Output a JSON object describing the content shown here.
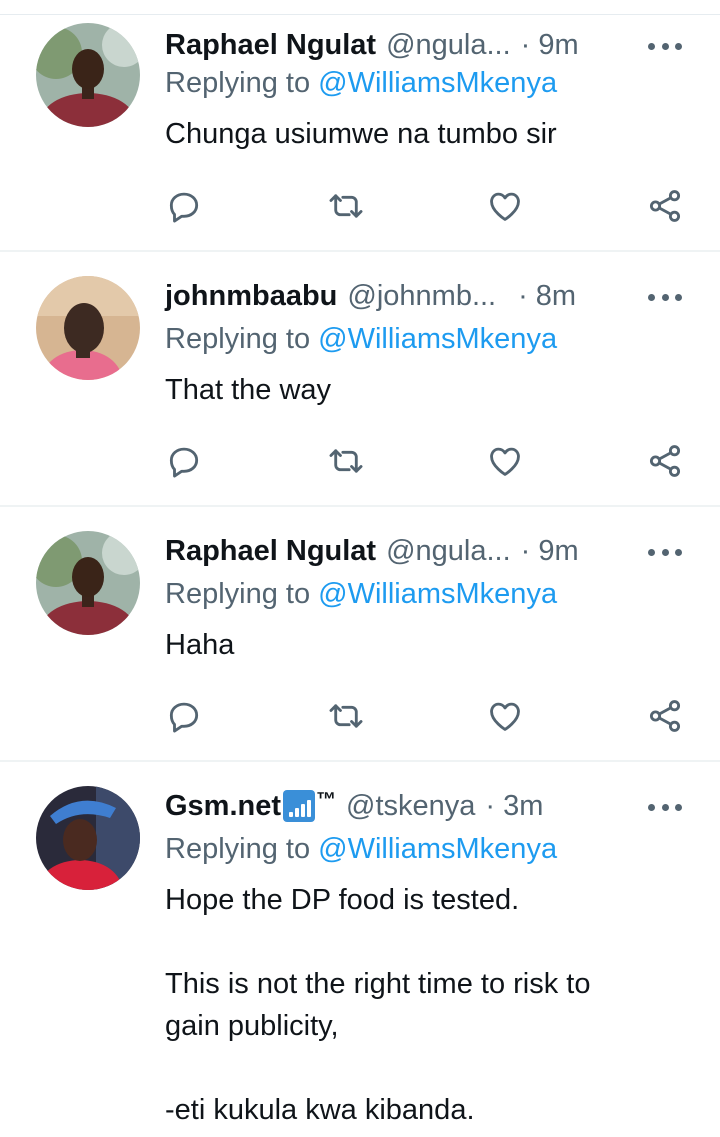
{
  "tweets": [
    {
      "name": "Raphael Ngulat",
      "handle": "@ngula...",
      "dot": "·",
      "time": "9m",
      "replying_prefix": "Replying to ",
      "replying_to": "@WilliamsMkenya",
      "lines": [
        "Chunga usiumwe na tumbo sir"
      ],
      "avatar": "avatar-raphael"
    },
    {
      "name": "johnmbaabu",
      "handle": "@johnmb...",
      "dot": "·",
      "time": "8m",
      "replying_prefix": "Replying to ",
      "replying_to": "@WilliamsMkenya",
      "lines": [
        "That the way"
      ],
      "avatar": "avatar-john"
    },
    {
      "name": "Raphael Ngulat",
      "handle": "@ngula...",
      "dot": "·",
      "time": "9m",
      "replying_prefix": "Replying to ",
      "replying_to": "@WilliamsMkenya",
      "lines": [
        "Haha"
      ],
      "avatar": "avatar-raphael"
    },
    {
      "name": "Gsm.net",
      "name_suffix": "™",
      "handle": "@tskenya",
      "dot": "·",
      "time": "3m",
      "replying_prefix": "Replying to ",
      "replying_to": "@WilliamsMkenya",
      "lines": [
        "Hope the DP food is tested.",
        "",
        "This is not the right time to risk to",
        "gain publicity,",
        "",
        "-eti kukula kwa kibanda."
      ],
      "avatar": "avatar-gsm"
    }
  ],
  "action_icons": [
    "reply-icon",
    "retweet-icon",
    "like-icon",
    "share-icon"
  ],
  "colors": {
    "text": "#0f1419",
    "secondary": "#536471",
    "link": "#1d9bf0",
    "icon": "#536471",
    "divider": "#eff3f4"
  }
}
